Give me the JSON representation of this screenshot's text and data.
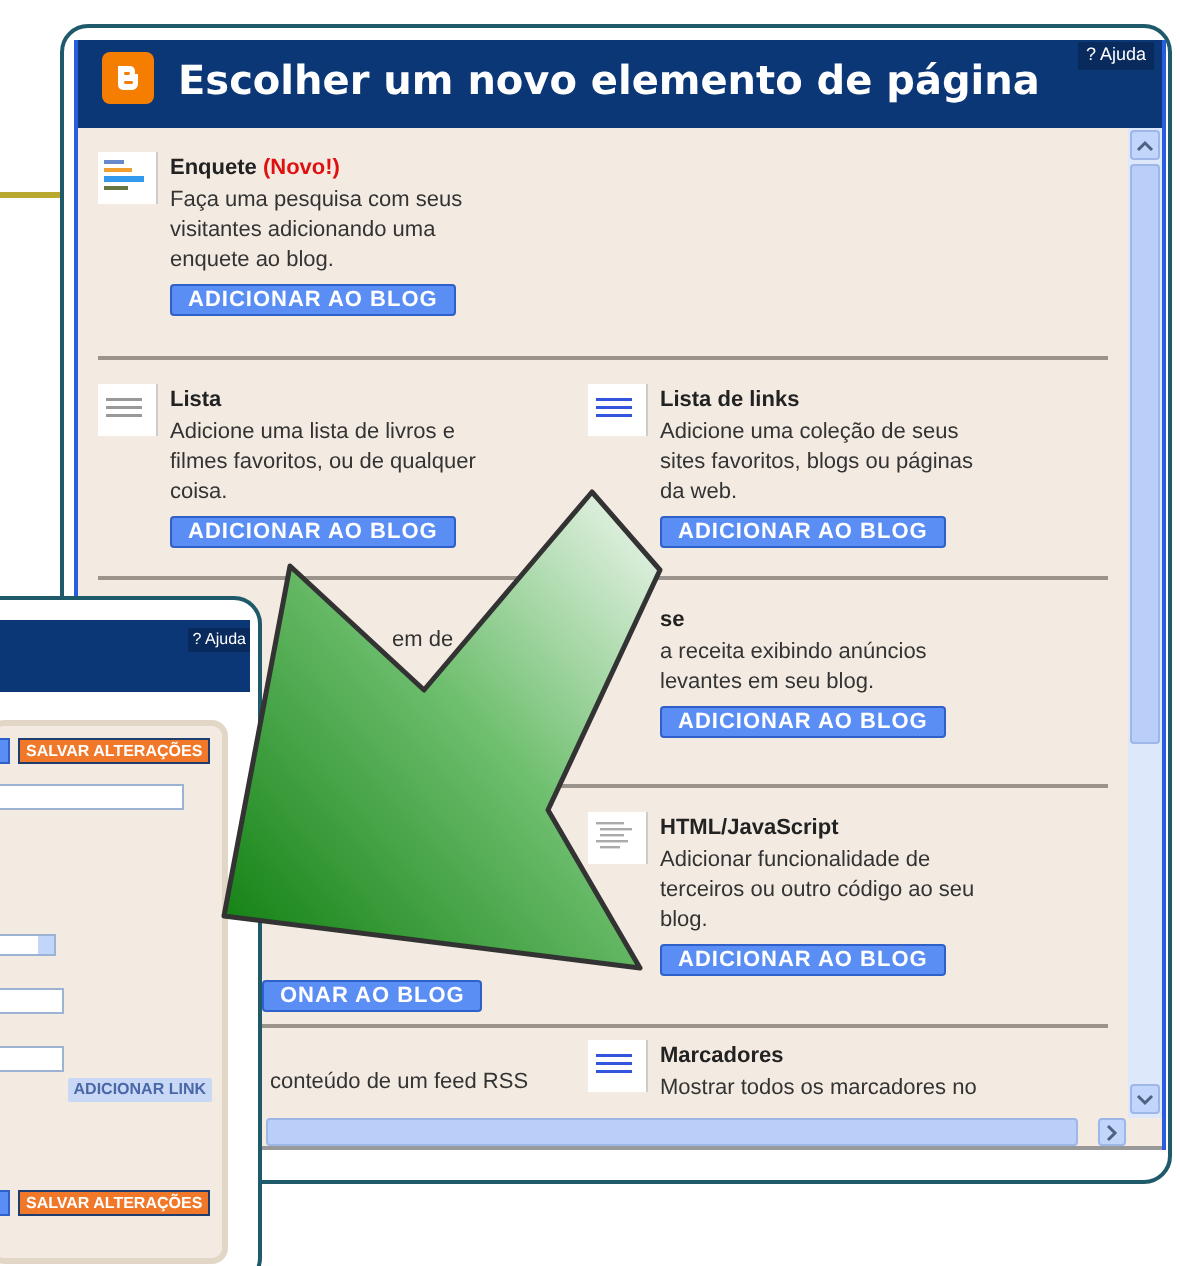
{
  "main_window": {
    "title": "Escolher um novo elemento de página",
    "help_link": "? Ajuda",
    "rows": [
      {
        "cells": [
          {
            "kind": "full",
            "title": "Enquete",
            "badge": "(Novo!)",
            "lines": [
              "Faça uma pesquisa com seus",
              "visitantes adicionando uma",
              "enquete ao blog."
            ],
            "button": "ADICIONAR AO BLOG"
          }
        ]
      },
      {
        "cells": [
          {
            "kind": "full",
            "title": "Lista",
            "lines": [
              "Adicione uma lista de livros e",
              "filmes favoritos, ou de qualquer",
              "coisa."
            ],
            "button": "ADICIONAR AO BLOG"
          },
          {
            "kind": "full",
            "title": "Lista de links",
            "lines": [
              "Adicione uma coleção de seus",
              "sites favoritos, blogs ou páginas",
              "da web."
            ],
            "button": "ADICIONAR AO BLOG"
          }
        ]
      },
      {
        "cells": [
          {
            "kind": "covered",
            "lines": [
              "em de"
            ]
          },
          {
            "kind": "full",
            "title": "se",
            "lines": [
              "a receita exibindo anúncios",
              "levantes em seu blog."
            ],
            "button": "ADICIONAR AO BLOG"
          }
        ]
      },
      {
        "cells": [
          {
            "kind": "covered",
            "button": "ONAR AO BLOG"
          },
          {
            "kind": "full",
            "title": "HTML/JavaScript",
            "lines": [
              "Adicionar funcionalidade de",
              "terceiros ou outro código ao seu",
              "blog."
            ],
            "button": "ADICIONAR AO BLOG"
          }
        ]
      },
      {
        "cells": [
          {
            "kind": "covered",
            "lines": [
              "conteúdo de um feed RSS"
            ]
          },
          {
            "kind": "full",
            "title": "Marcadores",
            "lines": [
              "Mostrar todos os marcadores no"
            ]
          }
        ]
      }
    ]
  },
  "small_window": {
    "help_link": "? Ajuda",
    "save_top": "SALVAR ALTERAÇÕES",
    "add_link": {
      "label": "ADICIONAR LINK",
      "disabled": true
    },
    "save_bottom": "SALVAR ALTERAÇÕES"
  }
}
